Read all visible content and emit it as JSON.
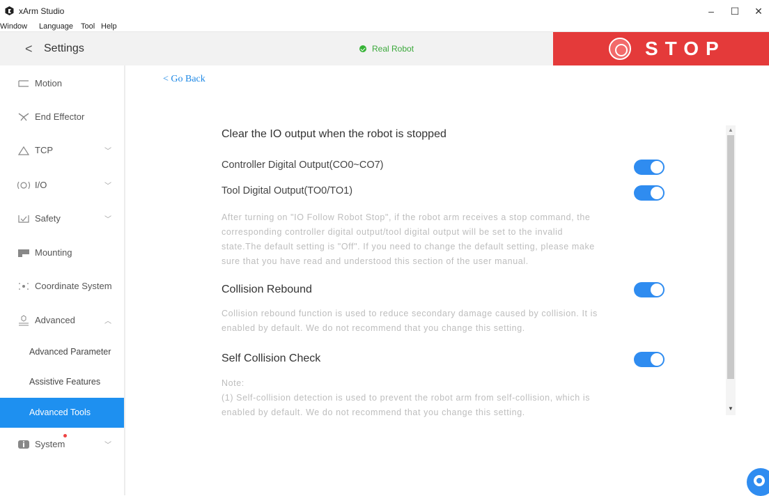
{
  "window": {
    "title": "xArm Studio",
    "minimize": "–",
    "maximize": "☐",
    "close": "✕"
  },
  "menu": [
    "Window",
    "Language",
    "Tool",
    "Help"
  ],
  "header": {
    "title": "Settings",
    "status": "Real Robot",
    "stop_label": "STOP"
  },
  "sidebar": {
    "items": [
      {
        "label": "Motion"
      },
      {
        "label": "End Effector"
      },
      {
        "label": "TCP"
      },
      {
        "label": "I/O"
      },
      {
        "label": "Safety"
      },
      {
        "label": "Mounting"
      },
      {
        "label": "Coordinate System"
      },
      {
        "label": "Advanced"
      },
      {
        "label": "System"
      }
    ],
    "sub_items": [
      {
        "label": "Advanced Parameter"
      },
      {
        "label": "Assistive Features"
      },
      {
        "label": "Advanced Tools",
        "active": true
      }
    ]
  },
  "main": {
    "go_back": "< Go Back",
    "io_section_title": "Clear the IO output when the robot is stopped",
    "controller_output_label": "Controller Digital Output(CO0~CO7)",
    "tool_output_label": "Tool Digital Output(TO0/TO1)",
    "io_description": [
      "After turning on \"IO Follow Robot Stop\", if the robot arm receives a stop command, the",
      "corresponding controller digital output/tool digital output will be set to the invalid",
      "state.The default setting is \"Off\". If you need to change the default setting, please make",
      "sure that you have read and understood this section of the user manual."
    ],
    "collision_rebound_label": "Collision Rebound",
    "collision_description": [
      "Collision rebound function is used to reduce secondary damage caused by collision. It is",
      "enabled by default. We do not recommend that you change this setting."
    ],
    "self_collision_label": "Self Collision Check",
    "self_collision_note": [
      "Note:",
      "(1) Self-collision detection is used to prevent the robot arm from self-collision, which is",
      "enabled by default. We do not recommend that you change this setting."
    ],
    "toggles": {
      "controller_output": true,
      "tool_output": true,
      "collision_rebound": true,
      "self_collision": true
    }
  },
  "colors": {
    "accent": "#2f8cf0",
    "stop": "#e43a3a",
    "status_ok": "#36b336",
    "active_nav": "#1e90f0"
  }
}
